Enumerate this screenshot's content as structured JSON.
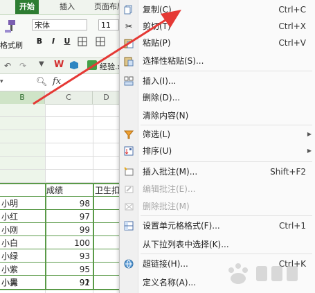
{
  "ribbon": {
    "tabs": [
      "开始",
      "插入",
      "页面布局"
    ],
    "format_painter_label": "格式刷",
    "font_name": "宋体",
    "font_size": "11",
    "bold": "B",
    "italic": "I",
    "underline": "U",
    "file_tab_label": "经验.x"
  },
  "formula_bar": {
    "fx_label": "fx"
  },
  "sheet": {
    "columns": [
      "B",
      "C",
      "D"
    ],
    "headers": {
      "score": "成绩",
      "hygiene": "卫生扣"
    },
    "rows": [
      {
        "name": "小明",
        "score": "98"
      },
      {
        "name": "小红",
        "score": "97"
      },
      {
        "name": "小刚",
        "score": "99"
      },
      {
        "name": "小白",
        "score": "100"
      },
      {
        "name": "小绿",
        "score": "93"
      },
      {
        "name": "小紫",
        "score": "95"
      },
      {
        "name": "小青",
        "score": "91"
      },
      {
        "name": "小黑",
        "score": "92"
      }
    ]
  },
  "context_menu": {
    "items": [
      {
        "label": "复制(C)",
        "shortcut": "Ctrl+C",
        "icon": "copy-icon",
        "disabled": false
      },
      {
        "label": "剪切(T)",
        "shortcut": "Ctrl+X",
        "icon": "scissors-icon",
        "disabled": false
      },
      {
        "label": "粘贴(P)",
        "shortcut": "Ctrl+V",
        "icon": "paste-icon",
        "disabled": false
      },
      {
        "label": "选择性粘贴(S)...",
        "shortcut": "",
        "icon": "paste-special-icon",
        "disabled": false
      },
      {
        "label": "插入(I)...",
        "shortcut": "",
        "icon": "insert-icon",
        "disabled": false
      },
      {
        "label": "删除(D)...",
        "shortcut": "",
        "icon": "",
        "disabled": false
      },
      {
        "label": "清除内容(N)",
        "shortcut": "",
        "icon": "",
        "disabled": false
      },
      {
        "label": "筛选(L)",
        "shortcut": "",
        "icon": "filter-icon",
        "disabled": false,
        "submenu": true
      },
      {
        "label": "排序(U)",
        "shortcut": "",
        "icon": "sort-icon",
        "disabled": false,
        "submenu": true
      },
      {
        "label": "插入批注(M)...",
        "shortcut": "Shift+F2",
        "icon": "insert-comment-icon",
        "disabled": false
      },
      {
        "label": "编辑批注(E)...",
        "shortcut": "",
        "icon": "edit-comment-icon",
        "disabled": true
      },
      {
        "label": "删除批注(M)",
        "shortcut": "",
        "icon": "delete-comment-icon",
        "disabled": true
      },
      {
        "label": "设置单元格格式(F)...",
        "shortcut": "Ctrl+1",
        "icon": "format-cells-icon",
        "disabled": false
      },
      {
        "label": "从下拉列表中选择(K)...",
        "shortcut": "",
        "icon": "",
        "disabled": false
      },
      {
        "label": "超链接(H)...",
        "shortcut": "Ctrl+K",
        "icon": "hyperlink-icon",
        "disabled": false
      },
      {
        "label": "定义名称(A)...",
        "shortcut": "",
        "icon": "",
        "disabled": false
      }
    ]
  },
  "colors": {
    "accent": "#2e7d32",
    "annotation_arrow": "#e53935",
    "table_border": "#5a9a48"
  }
}
